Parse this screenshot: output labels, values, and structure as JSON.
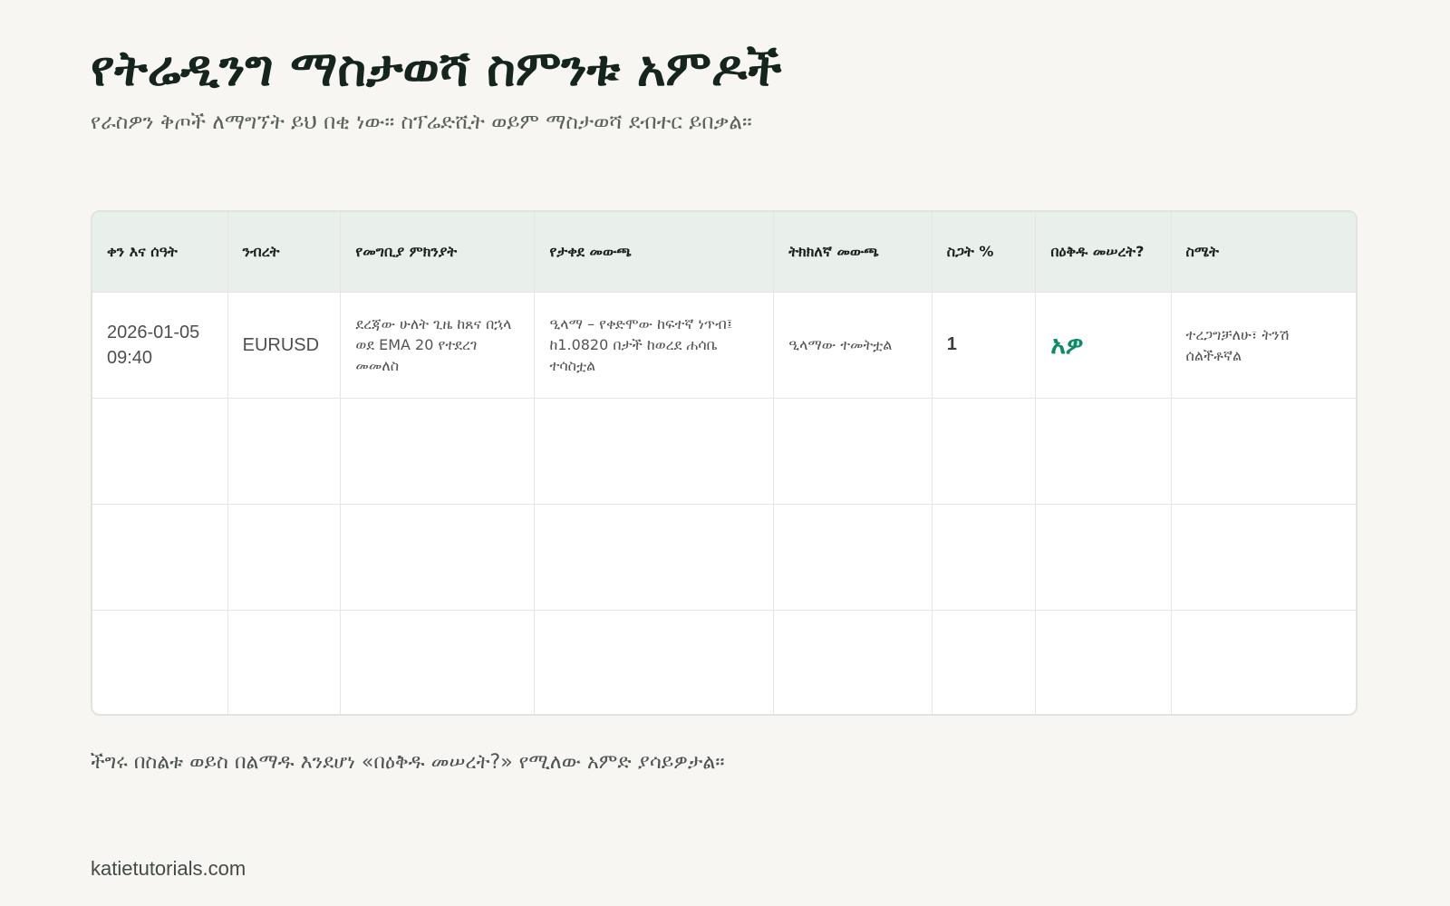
{
  "page": {
    "title": "የትሬዲንግ ማስታወሻ ስምንቱ አምዶች",
    "subtitle": "የራስዎን ቅጦች ለማግኘት ይህ በቂ ነው። ስፕሬድሺት ወይም ማስታወሻ ደብተር ይበቃል።",
    "footer_note": "ችግሩ በስልቱ ወይስ በልማዱ እንደሆነ «በዕቅዱ መሠረት?» የሚለው አምድ ያሳይዎታል።",
    "site": "katietutorials.com"
  },
  "journal": {
    "columns": [
      "ቀን እና ሰዓት",
      "ንብረት",
      "የመግቢያ ምክንያት",
      "የታቀደ መውጫ",
      "ትክክለኛ መውጫ",
      "ስጋት %",
      "በዕቅዱ መሠረት?",
      "ስሜት"
    ],
    "entry": {
      "datetime": "2026-01-05 09:40",
      "asset": "EURUSD",
      "entry_reason": "ደረጃው ሁለት ጊዜ ከጸና በኋላ ወደ EMA 20 የተደረገ መመለስ",
      "planned_exit": "ዒላማ – የቀድሞው ከፍተኛ ነጥብ፤ ከ1.0820 በታች ከወረደ ሐሳቤ ተሳስቷል",
      "actual_exit": "ዒላማው ተመትቷል",
      "risk_percent": "1",
      "per_plan": "አዎ",
      "emotion": "ተረጋግቻለሁ፣ ትንሽ ሰልችቶኛል"
    }
  },
  "colors": {
    "background": "#f7f6f2",
    "header_fill": "#e9efea",
    "accent_green": "#0f8a68",
    "title_text": "#15251d"
  }
}
